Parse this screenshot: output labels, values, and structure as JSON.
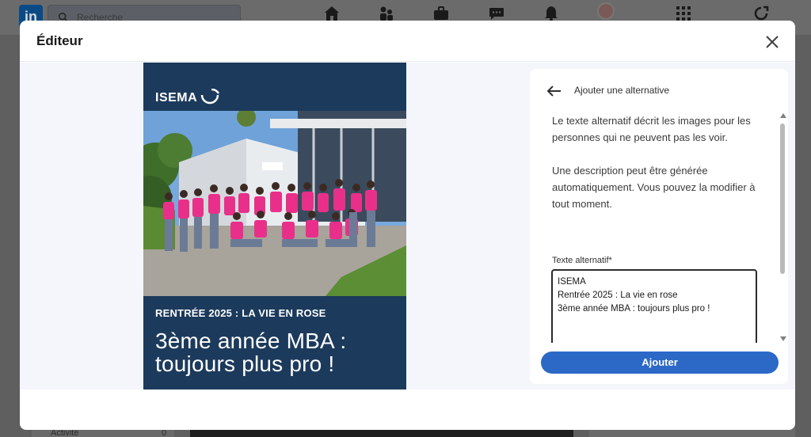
{
  "background": {
    "nav": {
      "logo": "in",
      "search_placeholder": "Recherche"
    },
    "sidebar": {
      "activity_label": "Activité",
      "activity_count": "0"
    }
  },
  "modal": {
    "title": "Éditeur",
    "post": {
      "brand": "ISEMA",
      "kicker": "RENTRÉE 2025 : LA VIE EN ROSE",
      "headline": "3ème année MBA : toujours plus pro !",
      "colors": {
        "background": "#1c3a5c",
        "shirts": "#e8308a"
      }
    },
    "alt_panel": {
      "title": "Ajouter une alternative",
      "description_1": "Le texte alternatif décrit les images pour les personnes qui ne peuvent pas les voir.",
      "description_2": "Une description peut être générée automatiquement. Vous pouvez la modifier à tout moment.",
      "field_label": "Texte alternatif*",
      "field_value": "ISEMA\nRentrée 2025 : La vie en rose\n3ème année MBA : toujours plus pro !",
      "submit_label": "Ajouter"
    }
  },
  "colors": {
    "accent": "#2c68c6"
  }
}
